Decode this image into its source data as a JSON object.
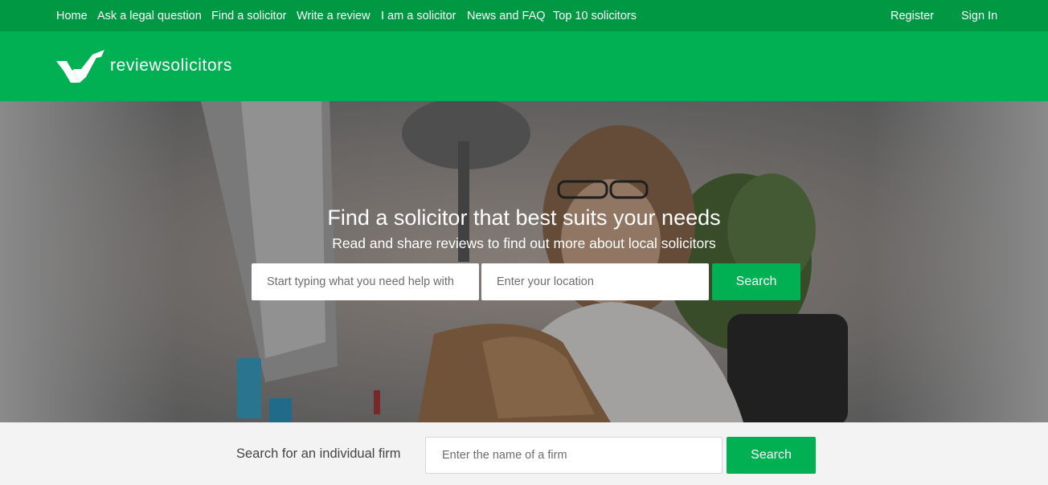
{
  "colors": {
    "nav_bg": "#009843",
    "brand_bg": "#00b052",
    "button_bg": "#00b052"
  },
  "topnav": {
    "items": [
      "Home",
      "Ask a legal question",
      "Find a solicitor",
      "Write a review",
      "I am a solicitor",
      "News and FAQ",
      "Top 10 solicitors"
    ],
    "register": "Register",
    "signin": "Sign In"
  },
  "brand": {
    "name": "reviewsolicitors",
    "icon": "checkmark-logo-icon"
  },
  "hero": {
    "title": "Find a solicitor that best suits your needs",
    "subtitle": "Read and share reviews to find out more about local solicitors",
    "need_placeholder": "Start typing what you need help with",
    "location_placeholder": "Enter your location",
    "search_label": "Search"
  },
  "firm_search": {
    "label": "Search for an individual firm",
    "placeholder": "Enter the name of a firm",
    "search_label": "Search"
  }
}
